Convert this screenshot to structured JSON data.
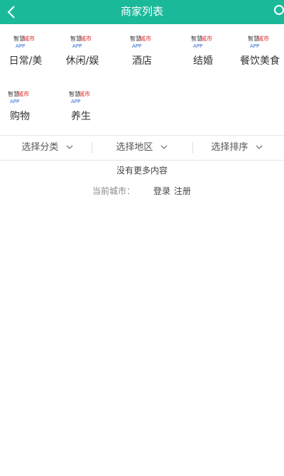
{
  "header": {
    "title": "商家列表",
    "back_icon": "chevron-left-icon",
    "search_icon": "search-icon",
    "bg_color": "#1ab99a"
  },
  "categories": [
    {
      "label": "日常/美",
      "logo_text": "智慧城市APP"
    },
    {
      "label": "休闲/娱",
      "logo_text": "智慧城市APP"
    },
    {
      "label": "酒店",
      "logo_text": "智慧城市APP"
    },
    {
      "label": "结婚",
      "logo_text": "智慧城市APP"
    },
    {
      "label": "餐饮美食",
      "logo_text": "智慧城市APP"
    },
    {
      "label": "购物",
      "logo_text": "智慧城市APP"
    },
    {
      "label": "养生",
      "logo_text": "智慧城市APP"
    }
  ],
  "filters": [
    {
      "label": "选择分类"
    },
    {
      "label": "选择地区"
    },
    {
      "label": "选择排序"
    }
  ],
  "status": {
    "no_more": "没有更多内容",
    "current_city_label": "当前城市：",
    "login": "登录",
    "register": "注册"
  }
}
